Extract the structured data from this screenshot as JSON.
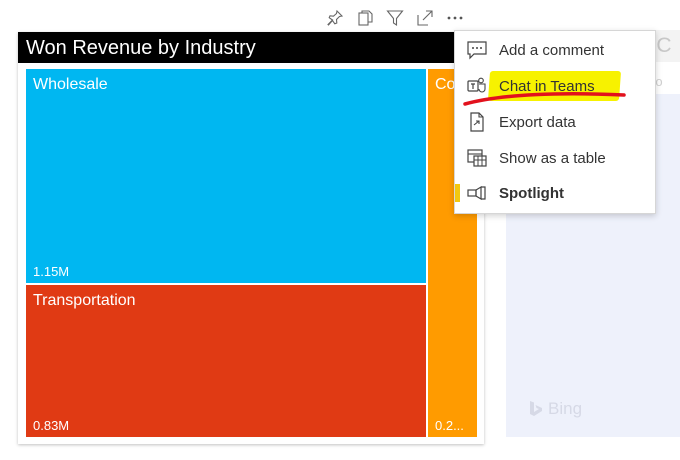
{
  "background_visual": {
    "title_fragment": "y C",
    "subtitle_fragment": "egio",
    "map_attribution": "Bing"
  },
  "toolbar": {
    "icons": [
      "pin-icon",
      "copy-icon",
      "filter-icon",
      "focus-mode-icon",
      "more-options-icon"
    ]
  },
  "treemap": {
    "title": "Won Revenue by Industry",
    "tiles": [
      {
        "label": "Wholesale",
        "value": "1.15M",
        "color": "#00b7f1"
      },
      {
        "label": "Transportation",
        "value": "0.83M",
        "color": "#e03a14"
      },
      {
        "label": "Co",
        "value": "0.2...",
        "color": "#ff9b00"
      }
    ]
  },
  "context_menu": {
    "items": [
      {
        "label": "Add a comment",
        "icon": "comment-icon"
      },
      {
        "label": "Chat in Teams",
        "icon": "teams-icon",
        "highlighted": true
      },
      {
        "label": "Export data",
        "icon": "export-icon"
      },
      {
        "label": "Show as a table",
        "icon": "table-icon"
      },
      {
        "label": "Spotlight",
        "icon": "spotlight-icon",
        "bold": true
      }
    ],
    "highlight_color": "#f7f200",
    "annotation_color": "#e2111d"
  }
}
